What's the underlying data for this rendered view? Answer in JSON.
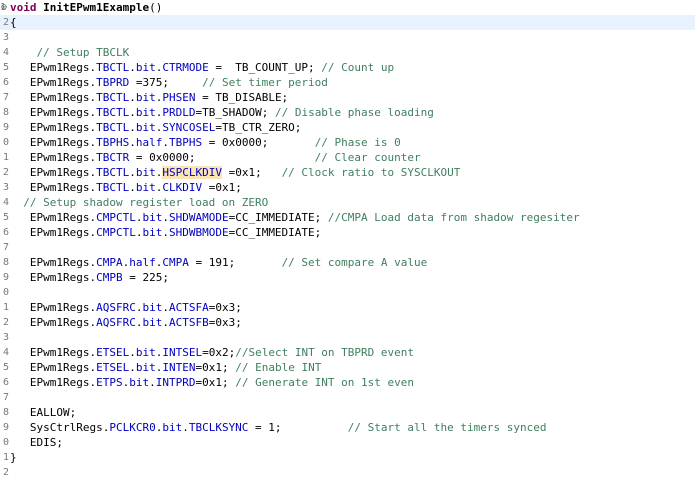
{
  "editor": {
    "lines": [
      {
        "n": "1",
        "marker": "⊖",
        "segs": [
          {
            "t": "void",
            "c": "kw"
          },
          {
            "t": " "
          },
          {
            "t": "InitEPwm1Example",
            "c": "fn"
          },
          {
            "t": "()"
          }
        ]
      },
      {
        "n": "2",
        "segs": [
          {
            "t": "{"
          }
        ]
      },
      {
        "n": "3",
        "segs": []
      },
      {
        "n": "4",
        "segs": [
          {
            "t": "    "
          },
          {
            "t": "// Setup TBCLK",
            "c": "cmt"
          }
        ]
      },
      {
        "n": "5",
        "segs": [
          {
            "t": "   EPwm1Regs."
          },
          {
            "t": "TBCTL",
            "c": "fld"
          },
          {
            "t": "."
          },
          {
            "t": "bit",
            "c": "fld"
          },
          {
            "t": "."
          },
          {
            "t": "CTRMODE",
            "c": "fld"
          },
          {
            "t": " =  TB_COUNT_UP; "
          },
          {
            "t": "// Count up",
            "c": "cmt"
          }
        ]
      },
      {
        "n": "6",
        "segs": [
          {
            "t": "   EPwm1Regs."
          },
          {
            "t": "TBPRD",
            "c": "fld"
          },
          {
            "t": " =375;     "
          },
          {
            "t": "// Set timer period",
            "c": "cmt"
          }
        ]
      },
      {
        "n": "7",
        "segs": [
          {
            "t": "   EPwm1Regs."
          },
          {
            "t": "TBCTL",
            "c": "fld"
          },
          {
            "t": "."
          },
          {
            "t": "bit",
            "c": "fld"
          },
          {
            "t": "."
          },
          {
            "t": "PHSEN",
            "c": "fld"
          },
          {
            "t": " = TB_DISABLE;"
          }
        ]
      },
      {
        "n": "8",
        "segs": [
          {
            "t": "   EPwm1Regs."
          },
          {
            "t": "TBCTL",
            "c": "fld"
          },
          {
            "t": "."
          },
          {
            "t": "bit",
            "c": "fld"
          },
          {
            "t": "."
          },
          {
            "t": "PRDLD",
            "c": "fld"
          },
          {
            "t": "=TB_SHADOW; "
          },
          {
            "t": "// Disable phase loading",
            "c": "cmt"
          }
        ]
      },
      {
        "n": "9",
        "segs": [
          {
            "t": "   EPwm1Regs."
          },
          {
            "t": "TBCTL",
            "c": "fld"
          },
          {
            "t": "."
          },
          {
            "t": "bit",
            "c": "fld"
          },
          {
            "t": "."
          },
          {
            "t": "SYNCOSEL",
            "c": "fld"
          },
          {
            "t": "=TB_CTR_ZERO;"
          }
        ]
      },
      {
        "n": "0",
        "segs": [
          {
            "t": "   EPwm1Regs."
          },
          {
            "t": "TBPHS",
            "c": "fld"
          },
          {
            "t": "."
          },
          {
            "t": "half",
            "c": "fld"
          },
          {
            "t": "."
          },
          {
            "t": "TBPHS",
            "c": "fld"
          },
          {
            "t": " = 0x0000;       "
          },
          {
            "t": "// Phase is 0",
            "c": "cmt"
          }
        ]
      },
      {
        "n": "1",
        "segs": [
          {
            "t": "   EPwm1Regs."
          },
          {
            "t": "TBCTR",
            "c": "fld"
          },
          {
            "t": " = 0x0000;                  "
          },
          {
            "t": "// Clear counter",
            "c": "cmt"
          }
        ]
      },
      {
        "n": "2",
        "segs": [
          {
            "t": "   EPwm1Regs."
          },
          {
            "t": "TBCTL",
            "c": "fld"
          },
          {
            "t": "."
          },
          {
            "t": "bit",
            "c": "fld"
          },
          {
            "t": "."
          },
          {
            "t": "HSPCLKDIV",
            "c": "fld hl"
          },
          {
            "t": " =0x1;   "
          },
          {
            "t": "// Clock ratio to SYSCLKOUT",
            "c": "cmt"
          }
        ]
      },
      {
        "n": "3",
        "segs": [
          {
            "t": "   EPwm1Regs."
          },
          {
            "t": "TBCTL",
            "c": "fld"
          },
          {
            "t": "."
          },
          {
            "t": "bit",
            "c": "fld"
          },
          {
            "t": "."
          },
          {
            "t": "CLKDIV",
            "c": "fld"
          },
          {
            "t": " =0x1;"
          }
        ]
      },
      {
        "n": "4",
        "segs": [
          {
            "t": "  "
          },
          {
            "t": "// Setup shadow register load on ZERO",
            "c": "cmt"
          }
        ]
      },
      {
        "n": "5",
        "segs": [
          {
            "t": "   EPwm1Regs."
          },
          {
            "t": "CMPCTL",
            "c": "fld"
          },
          {
            "t": "."
          },
          {
            "t": "bit",
            "c": "fld"
          },
          {
            "t": "."
          },
          {
            "t": "SHDWAMODE",
            "c": "fld"
          },
          {
            "t": "=CC_IMMEDIATE; "
          },
          {
            "t": "//CMPA Load data from shadow regesiter",
            "c": "cmt"
          }
        ]
      },
      {
        "n": "6",
        "segs": [
          {
            "t": "   EPwm1Regs."
          },
          {
            "t": "CMPCTL",
            "c": "fld"
          },
          {
            "t": "."
          },
          {
            "t": "bit",
            "c": "fld"
          },
          {
            "t": "."
          },
          {
            "t": "SHDWBMODE",
            "c": "fld"
          },
          {
            "t": "=CC_IMMEDIATE;"
          }
        ]
      },
      {
        "n": "7",
        "segs": []
      },
      {
        "n": "8",
        "segs": [
          {
            "t": "   EPwm1Regs."
          },
          {
            "t": "CMPA",
            "c": "fld"
          },
          {
            "t": "."
          },
          {
            "t": "half",
            "c": "fld"
          },
          {
            "t": "."
          },
          {
            "t": "CMPA",
            "c": "fld"
          },
          {
            "t": " = 191;       "
          },
          {
            "t": "// Set compare A value",
            "c": "cmt"
          }
        ]
      },
      {
        "n": "9",
        "segs": [
          {
            "t": "   EPwm1Regs."
          },
          {
            "t": "CMPB",
            "c": "fld"
          },
          {
            "t": " = 225;"
          }
        ]
      },
      {
        "n": "0",
        "segs": []
      },
      {
        "n": "1",
        "segs": [
          {
            "t": "   EPwm1Regs."
          },
          {
            "t": "AQSFRC",
            "c": "fld"
          },
          {
            "t": "."
          },
          {
            "t": "bit",
            "c": "fld"
          },
          {
            "t": "."
          },
          {
            "t": "ACTSFA",
            "c": "fld"
          },
          {
            "t": "=0x3;"
          }
        ]
      },
      {
        "n": "2",
        "segs": [
          {
            "t": "   EPwm1Regs."
          },
          {
            "t": "AQSFRC",
            "c": "fld"
          },
          {
            "t": "."
          },
          {
            "t": "bit",
            "c": "fld"
          },
          {
            "t": "."
          },
          {
            "t": "ACTSFB",
            "c": "fld"
          },
          {
            "t": "=0x3;"
          }
        ]
      },
      {
        "n": "3",
        "segs": []
      },
      {
        "n": "4",
        "segs": [
          {
            "t": "   EPwm1Regs."
          },
          {
            "t": "ETSEL",
            "c": "fld"
          },
          {
            "t": "."
          },
          {
            "t": "bit",
            "c": "fld"
          },
          {
            "t": "."
          },
          {
            "t": "INTSEL",
            "c": "fld"
          },
          {
            "t": "=0x2;"
          },
          {
            "t": "//Select INT on TBPRD event",
            "c": "cmt"
          }
        ]
      },
      {
        "n": "5",
        "segs": [
          {
            "t": "   EPwm1Regs."
          },
          {
            "t": "ETSEL",
            "c": "fld"
          },
          {
            "t": "."
          },
          {
            "t": "bit",
            "c": "fld"
          },
          {
            "t": "."
          },
          {
            "t": "INTEN",
            "c": "fld"
          },
          {
            "t": "=0x1; "
          },
          {
            "t": "// Enable INT",
            "c": "cmt"
          }
        ]
      },
      {
        "n": "6",
        "segs": [
          {
            "t": "   EPwm1Regs."
          },
          {
            "t": "ETPS",
            "c": "fld"
          },
          {
            "t": "."
          },
          {
            "t": "bit",
            "c": "fld"
          },
          {
            "t": "."
          },
          {
            "t": "INTPRD",
            "c": "fld"
          },
          {
            "t": "=0x1; "
          },
          {
            "t": "// Generate INT on 1st even",
            "c": "cmt"
          }
        ]
      },
      {
        "n": "7",
        "segs": []
      },
      {
        "n": "8",
        "segs": [
          {
            "t": "   EALLOW;"
          }
        ]
      },
      {
        "n": "9",
        "segs": [
          {
            "t": "   SysCtrlRegs."
          },
          {
            "t": "PCLKCR0",
            "c": "fld"
          },
          {
            "t": "."
          },
          {
            "t": "bit",
            "c": "fld"
          },
          {
            "t": "."
          },
          {
            "t": "TBCLKSYNC",
            "c": "fld"
          },
          {
            "t": " = 1;          "
          },
          {
            "t": "// Start all the timers synced",
            "c": "cmt"
          }
        ]
      },
      {
        "n": "0",
        "segs": [
          {
            "t": "   EDIS;"
          }
        ]
      },
      {
        "n": "1",
        "segs": [
          {
            "t": "}"
          }
        ]
      },
      {
        "n": "2",
        "segs": []
      }
    ]
  }
}
